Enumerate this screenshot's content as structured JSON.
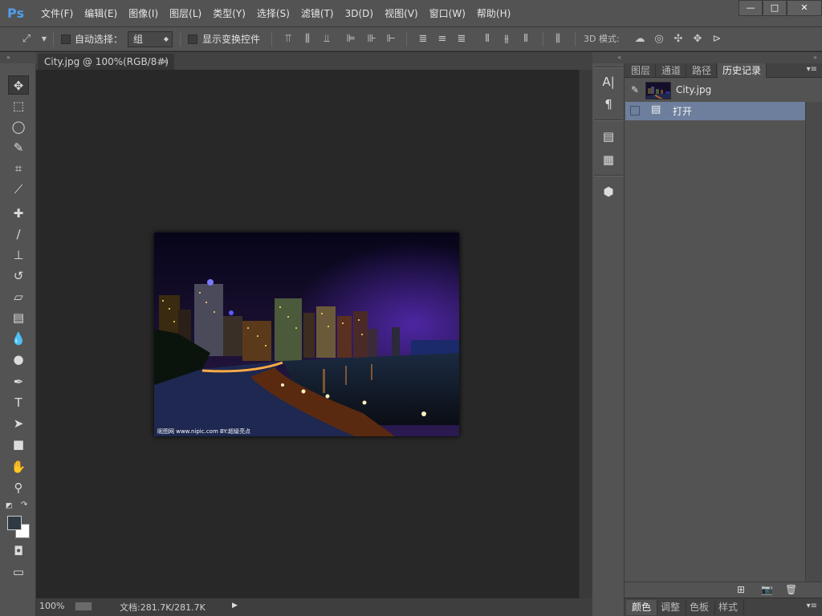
{
  "app": {
    "logo": "Ps"
  },
  "menu": [
    "文件(F)",
    "编辑(E)",
    "图像(I)",
    "图层(L)",
    "类型(Y)",
    "选择(S)",
    "滤镜(T)",
    "3D(D)",
    "视图(V)",
    "窗口(W)",
    "帮助(H)"
  ],
  "window_controls": {
    "minimize": "—",
    "maximize": "□",
    "close": "✕"
  },
  "options": {
    "auto_select_label": "自动选择：",
    "auto_select_value": "组",
    "show_transform_label": "显示变换控件",
    "mode_3d_label": "3D 模式:"
  },
  "document": {
    "tab_title": "City.jpg @ 100%(RGB/8#)",
    "tab_close": "×",
    "zoom": "100%",
    "size_info": "文档:281.7K/281.7K",
    "watermark": "昵图网 www.nipic.com  BY:超级亮点"
  },
  "history_panel": {
    "tabs": [
      "图层",
      "通道",
      "路径",
      "历史记录"
    ],
    "active_tab": "历史记录",
    "snapshot_name": "City.jpg",
    "entries": [
      "打开"
    ]
  },
  "bottom_tabs": [
    "颜色",
    "调整",
    "色板",
    "样式"
  ],
  "icons": {
    "move": "move-icon",
    "marquee": "marquee-icon",
    "lasso": "lasso-icon",
    "quick_select": "quick-select-icon",
    "crop": "crop-icon",
    "eyedropper": "eyedropper-icon",
    "healing": "healing-brush-icon",
    "brush": "brush-icon",
    "stamp": "clone-stamp-icon",
    "history_brush": "history-brush-icon",
    "eraser": "eraser-icon",
    "gradient": "gradient-icon",
    "blur": "blur-icon",
    "dodge": "dodge-icon",
    "pen": "pen-icon",
    "type": "type-icon",
    "path_select": "path-selection-icon",
    "shape": "rectangle-shape-icon",
    "hand": "hand-icon",
    "zoom": "zoom-icon"
  },
  "colors": {
    "accent": "#4f9ee8",
    "history_selection": "#6d7f9c",
    "foreground": "#2f3a44",
    "background": "#ffffff"
  }
}
